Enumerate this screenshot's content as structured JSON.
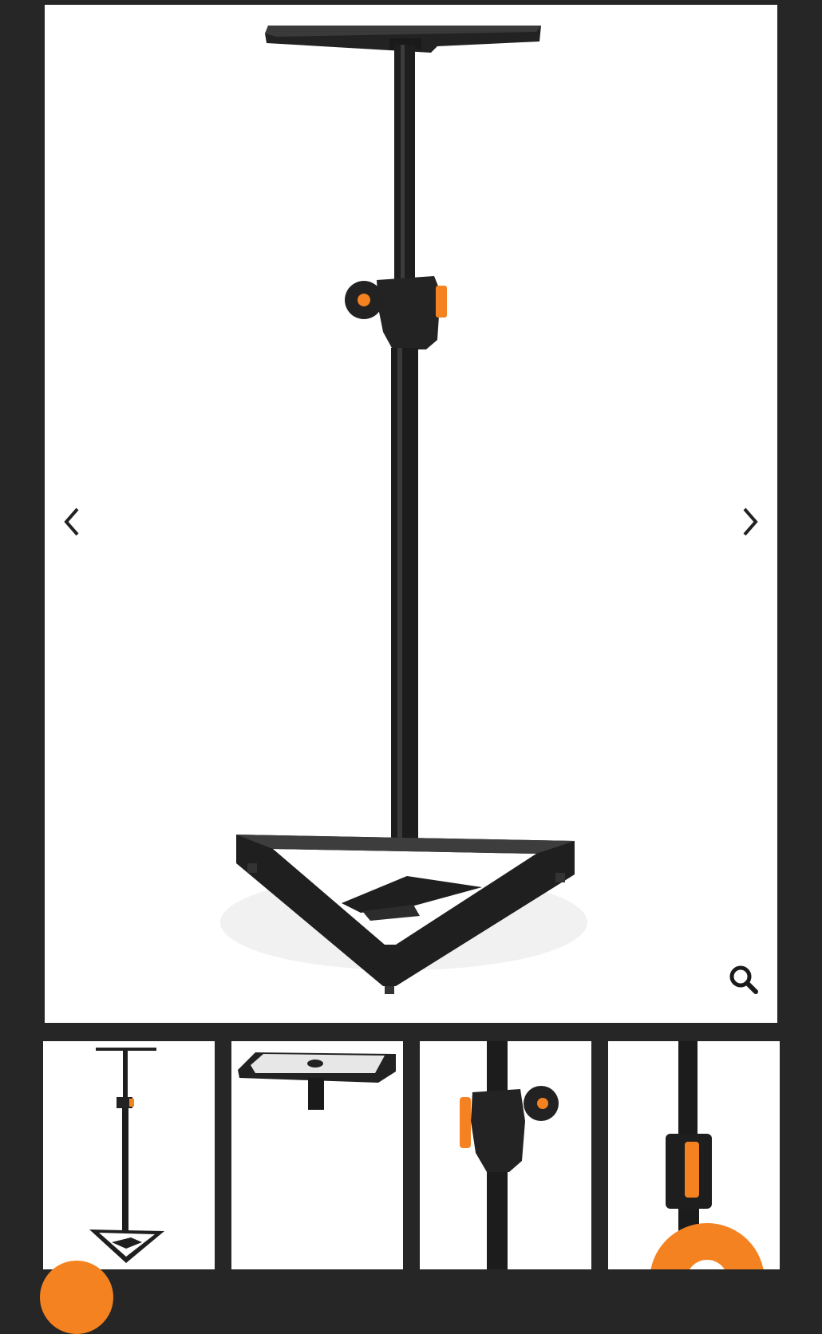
{
  "gallery": {
    "main_image": {
      "alt": "speaker-stand-front",
      "icons": {
        "prev": "chevron-left-icon",
        "next": "chevron-right-icon",
        "zoom": "magnifier-icon"
      }
    },
    "thumbnails": [
      {
        "alt": "speaker-stand-full-view",
        "selected": true
      },
      {
        "alt": "speaker-stand-top-plate",
        "selected": false
      },
      {
        "alt": "speaker-stand-clamp-closeup",
        "selected": false
      },
      {
        "alt": "speaker-stand-lock-closeup",
        "selected": false
      }
    ]
  },
  "colors": {
    "background": "#262626",
    "accent": "#f58220",
    "stand": "#1c1c1c"
  }
}
